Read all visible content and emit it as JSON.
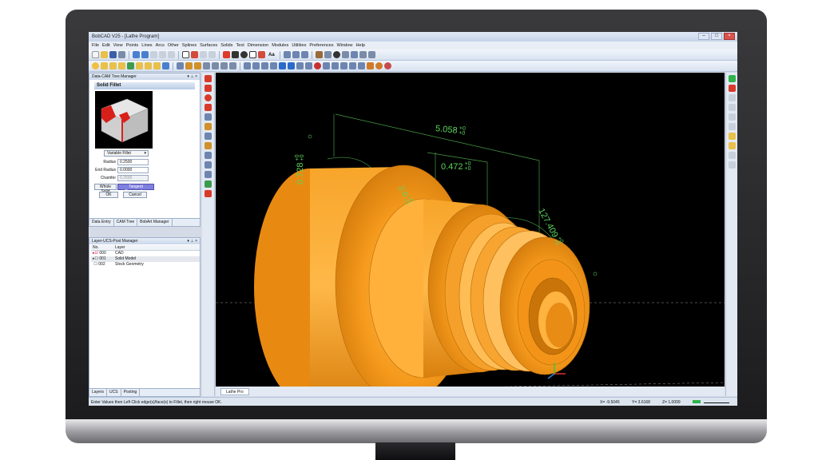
{
  "app": {
    "title": "BobCAD V25 - [Lathe Program]"
  },
  "menu": [
    "File",
    "Edit",
    "View",
    "Points",
    "Lines",
    "Arcs",
    "Other",
    "Splines",
    "Surfaces",
    "Solids",
    "Text",
    "Dimension",
    "Modules",
    "Utilities",
    "Preferences",
    "Window",
    "Help"
  ],
  "toolbar": {
    "text_tool": "Aa"
  },
  "cam_panel": {
    "title": "Data-CAM Tree Manager",
    "feature_title": "Solid Fillet",
    "fillet_type": "Variable Fillet",
    "fields": [
      {
        "label": "Radius",
        "value": "0.2500",
        "disabled": false
      },
      {
        "label": "End Radius",
        "value": "0.0000",
        "disabled": false
      },
      {
        "label": "Chamfer",
        "value": "0.2500",
        "disabled": true
      }
    ],
    "whole_solid": "Whole Solid",
    "tangent_propagation": "Tangent Propagation",
    "ok": "OK",
    "cancel": "Cancel",
    "tabs": [
      "Data Entry",
      "CAM Tree",
      "BobArt Manager"
    ]
  },
  "layer_panel": {
    "title": "Layer-UCS-Post Manager",
    "headers": [
      "No.",
      "Layer"
    ],
    "rows": [
      {
        "no": "000",
        "name": "CAD"
      },
      {
        "no": "001",
        "name": "Solid Model"
      },
      {
        "no": "002",
        "name": "Stock Geometry"
      }
    ],
    "tabs": [
      "Layers",
      "UCS",
      "Posting"
    ]
  },
  "viewport": {
    "dimensions": [
      {
        "value": "5.058",
        "tol_upper": "+0",
        "tol_lower": "+0"
      },
      {
        "value": "0.472",
        "tol_upper": "+0",
        "tol_lower": "+0"
      },
      {
        "value": "0.728",
        "tol_upper": "+0",
        "tol_lower": "+0"
      },
      {
        "value": "127.409",
        "tol_upper": "+0",
        "tol_lower": "+0"
      },
      {
        "value": "2.0",
        "tol_upper": "+0",
        "tol_lower": "+0"
      }
    ],
    "colors": {
      "background": "#000000",
      "part": "#f59a1c",
      "dimension": "#5cd65c"
    }
  },
  "document_tab": "Lathe Pro",
  "status": {
    "prompt": "Enter Values then Left Click edge(s)/face(s) to Fillet, then right mouse OK.",
    "x": "X= -9.5045",
    "y": "Y= 3.6168",
    "z": "Z= 1.0099"
  }
}
